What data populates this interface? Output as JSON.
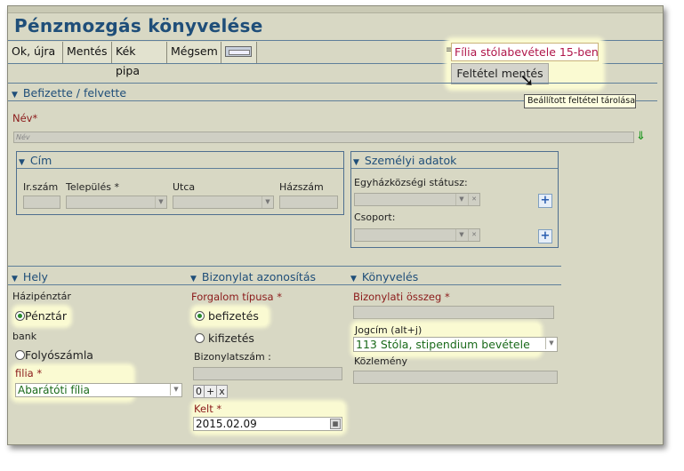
{
  "window": {
    "title": "Pénzmozgás könyvelése"
  },
  "toolbar": {
    "ok": "Ok, újra",
    "save": "Mentés",
    "blue_check": "Kék pipa",
    "cancel": "Mégsem",
    "saved_filter_value": "Fília stólabevétele 15-ben",
    "save_filter_button": "Feltétel mentés",
    "save_filter_tooltip": "Beállított feltétel tárolása"
  },
  "payer": {
    "section": "Befizette / felvette",
    "name_label": "Név*",
    "name_placeholder": "Név"
  },
  "address": {
    "section": "Cím",
    "zip_label": "Ir.szám",
    "city_label": "Település *",
    "street_label": "Utca",
    "house_label": "Házszám"
  },
  "personal": {
    "section": "Személyi adatok",
    "status_label": "Egyházközségi státusz:",
    "group_label": "Csoport:"
  },
  "place": {
    "section": "Hely",
    "cash_label": "Házipénztár",
    "cash_option": "Pénztár",
    "bank_label": "bank",
    "bank_option": "Folyószámla",
    "filia_label": "filia *",
    "filia_value": "Abarátóti fília"
  },
  "doc_id": {
    "section": "Bizonylat azonosítás",
    "traffic_label": "Forgalom típusa *",
    "payin": "befizetés",
    "payout": "kifizetés",
    "doc_number_label": "Bizonylatszám :",
    "counter_value": "0",
    "counter_plus": "+",
    "counter_x": "x",
    "date_label": "Kelt *",
    "date_value": "2015.02.09"
  },
  "booking": {
    "section": "Könyvelés",
    "amount_label": "Bizonylati összeg *",
    "title_label": "Jogcím (alt+j)",
    "title_value": "113 Stóla, stipendium bevétele",
    "note_label": "Közlemény"
  },
  "icons": {
    "dropdown": "chevron-down-icon",
    "add": "plus-icon",
    "clear": "close-icon",
    "pointer": "mouse-cursor-icon"
  },
  "colors": {
    "title": "#1f4e79",
    "required": "#8b1a1a",
    "value_green": "#1a6a1a",
    "background": "#d8d8c4",
    "highlight": "#fafad2"
  }
}
